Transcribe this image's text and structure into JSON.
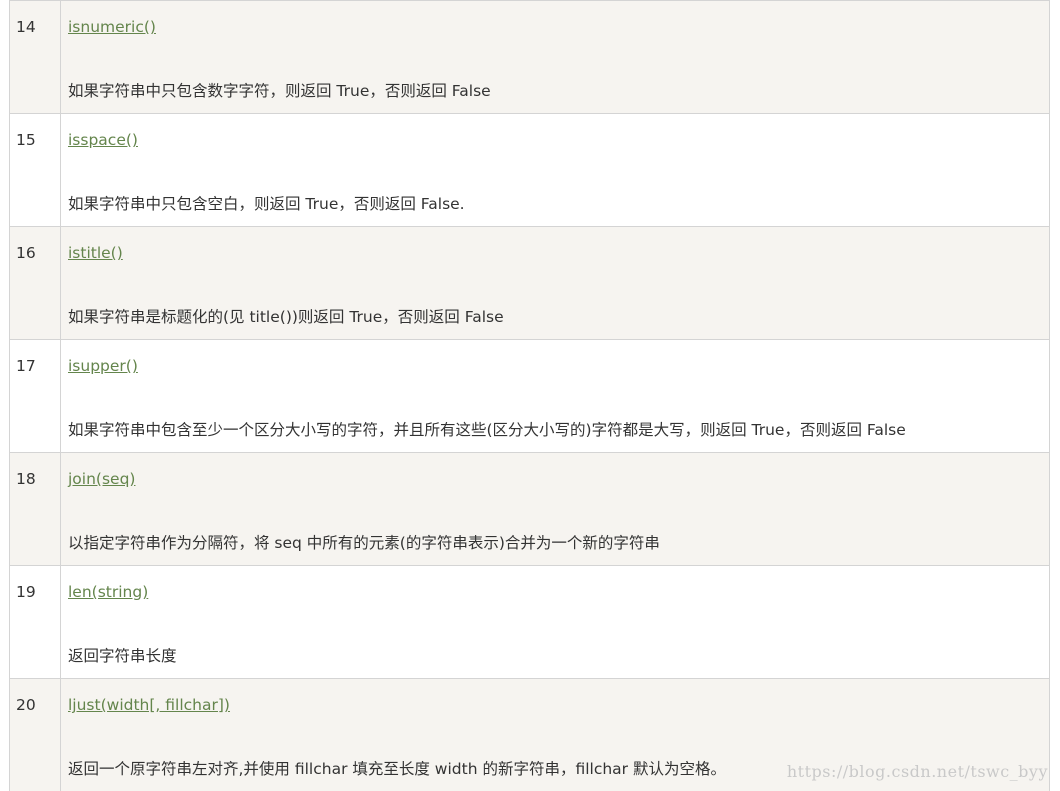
{
  "rows": [
    {
      "num": "14",
      "method": "isnumeric()",
      "desc": "如果字符串中只包含数字字符，则返回 True，否则返回 False"
    },
    {
      "num": "15",
      "method": "isspace()",
      "desc": "如果字符串中只包含空白，则返回 True，否则返回 False."
    },
    {
      "num": "16",
      "method": "istitle()",
      "desc": "如果字符串是标题化的(见 title())则返回 True，否则返回 False"
    },
    {
      "num": "17",
      "method": "isupper()",
      "desc": "如果字符串中包含至少一个区分大小写的字符，并且所有这些(区分大小写的)字符都是大写，则返回 True，否则返回 False"
    },
    {
      "num": "18",
      "method": "join(seq)",
      "desc": "以指定字符串作为分隔符，将 seq 中所有的元素(的字符串表示)合并为一个新的字符串"
    },
    {
      "num": "19",
      "method": "len(string)",
      "desc": "返回字符串长度"
    },
    {
      "num": "20",
      "method": "ljust(width[, fillchar])",
      "desc": "返回一个原字符串左对齐,并使用 fillchar 填充至长度 width 的新字符串，fillchar 默认为空格。"
    }
  ],
  "watermark": "https://blog.csdn.net/tswc_byy"
}
